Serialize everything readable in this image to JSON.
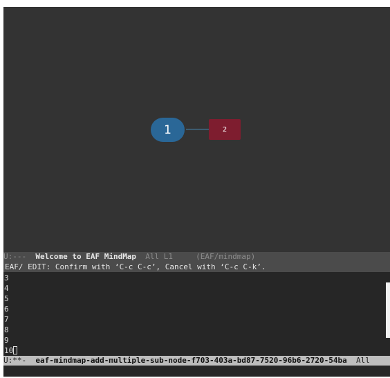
{
  "mindmap": {
    "nodes": [
      {
        "label": "1",
        "role": "root",
        "color": "#2a6797"
      },
      {
        "label": "2",
        "role": "child",
        "color": "#7e1d2f"
      }
    ],
    "edge_color": "#4a8fbd"
  },
  "mindmap_modeline": {
    "status": "U:---  ",
    "buffer_name": "Welcome to EAF MindMap",
    "position": "  All L1     ",
    "mode": "(EAF/mindmap)"
  },
  "edit_header": {
    "text": "EAF/ EDIT: Confirm with ‘C-c C-c’, Cancel with ‘C-c C-k’."
  },
  "edit_buffer": {
    "lines": [
      "3",
      "4",
      "5",
      "6",
      "7",
      "8",
      "9",
      "10"
    ]
  },
  "edit_modeline": {
    "status": "U:**-  ",
    "buffer_name": "eaf-mindmap-add-multiple-sub-node-f703-403a-bd87-7520-96b6-2720-54ba",
    "position": "  All"
  }
}
